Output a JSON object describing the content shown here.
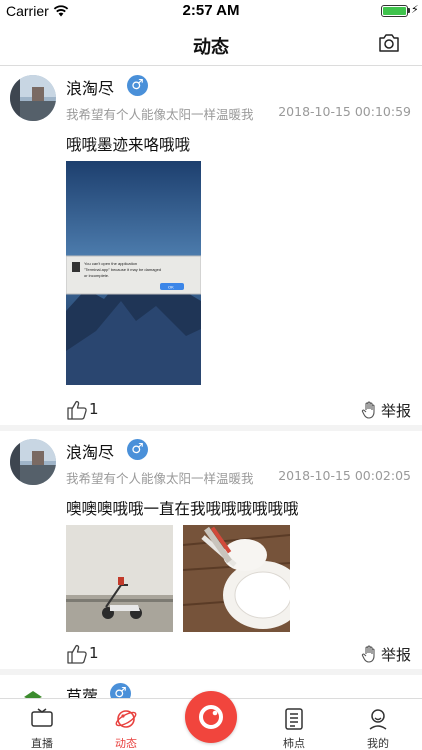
{
  "status_bar": {
    "carrier": "Carrier",
    "time": "2:57 AM",
    "battery_color": "#3fc34c"
  },
  "nav": {
    "title": "动态",
    "right_icon": "camera-icon"
  },
  "posts": [
    {
      "name": "浪淘尽",
      "gender_symbol": "♂",
      "signature": "我希望有个人能像太阳一样温暖我",
      "time": "2018-10-15 00:10:59",
      "content": "哦哦墨迹来咯哦哦",
      "likes": "1",
      "report_label": "举报",
      "dialog_text": "You can't open the application \"Terminal.app\" because it may be damaged or incomplete.",
      "dialog_button": "OK"
    },
    {
      "name": "浪淘尽",
      "gender_symbol": "♂",
      "signature": "我希望有个人能像太阳一样温暖我",
      "time": "2018-10-15 00:02:05",
      "content": "噢噢噢哦哦一直在我哦哦哦哦哦哦",
      "likes": "1",
      "report_label": "举报"
    },
    {
      "name": "苜蓿",
      "gender_symbol": "♂"
    }
  ],
  "tabs": [
    {
      "label": "直播",
      "icon": "tv-icon",
      "active": false
    },
    {
      "label": "动态",
      "icon": "planet-icon",
      "active": true
    },
    {
      "label": "",
      "icon": "record-icon",
      "active": false
    },
    {
      "label": "柿点",
      "icon": "document-icon",
      "active": false
    },
    {
      "label": "我的",
      "icon": "user-icon",
      "active": false
    }
  ],
  "colors": {
    "accent": "#e8423f",
    "gender_badge": "#4a90d9",
    "center_button": "#f1453d"
  }
}
